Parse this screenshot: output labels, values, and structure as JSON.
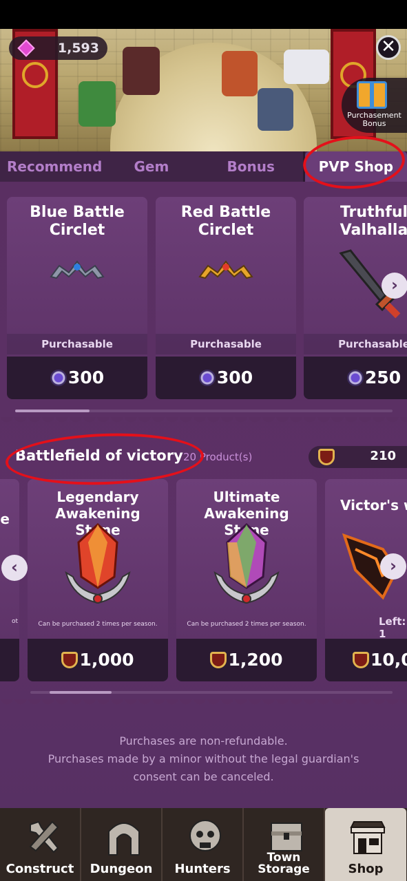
{
  "header": {
    "gem_count": "1,593",
    "close_symbol": "✕",
    "purchasement_bonus": "Purchasement Bonus"
  },
  "tabs": [
    {
      "label": "Recommend",
      "active": false
    },
    {
      "label": "Gem",
      "active": false
    },
    {
      "label": "Bonus",
      "active": false
    },
    {
      "label": "PVP Shop",
      "active": true
    }
  ],
  "pvp_items": [
    {
      "name": "Blue Battle Circlet",
      "status": "Purchasable",
      "price": "300",
      "color": "#2d7fe0"
    },
    {
      "name": "Red Battle Circlet",
      "status": "Purchasable",
      "price": "300",
      "color": "#e23a2a"
    },
    {
      "name": "Truthful Valhalla",
      "status": "Purchasable",
      "price": "250",
      "color": "#d05a2a"
    }
  ],
  "victory_section": {
    "title": "Battlefield of victory",
    "count": "20 Product(s)",
    "currency": "210"
  },
  "victory_items": [
    {
      "name": "Legendary Awakening Stone",
      "note": "Can be purchased 2 times per season.",
      "price": "1,000"
    },
    {
      "name": "Ultimate Awakening Stone",
      "note": "Can be purchased 2 times per season.",
      "price": "1,200"
    },
    {
      "name": "Victor's w",
      "note": "Left: 1",
      "price": "10,0"
    }
  ],
  "partial_left": {
    "name_fragment": "e",
    "note_fragment": "ot"
  },
  "disclaimer": {
    "line1": "Purchases are non-refundable.",
    "line2": "Purchases made by a minor without the legal guardian's",
    "line3": "consent can be canceled."
  },
  "bottom_nav": [
    {
      "label": "Construct",
      "icon": "hammer-icon"
    },
    {
      "label": "Dungeon",
      "icon": "gate-icon"
    },
    {
      "label": "Hunters",
      "icon": "skull-icon"
    },
    {
      "label": "Town Storage",
      "icon": "chest-icon"
    },
    {
      "label": "Shop",
      "icon": "shop-icon",
      "active": true
    }
  ],
  "colors": {
    "accent": "#6a3d78",
    "background": "#5a2f62",
    "annotation": "#e4101a"
  }
}
